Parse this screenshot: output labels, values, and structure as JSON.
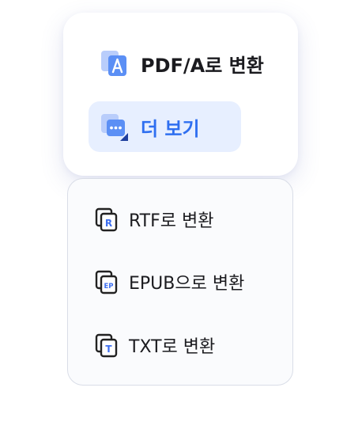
{
  "menu": {
    "items": [
      {
        "label": "PDF/A로 변환",
        "icon": "pdfa-convert-icon"
      },
      {
        "label": "더 보기",
        "icon": "more-formats-icon",
        "selected": true
      }
    ]
  },
  "submenu": {
    "items": [
      {
        "label": "RTF로 변환",
        "icon": "rtf-icon",
        "badge": "R"
      },
      {
        "label": "EPUB으로 변환",
        "icon": "epub-icon",
        "badge": "EP"
      },
      {
        "label": "TXT로 변환",
        "icon": "txt-icon",
        "badge": "T"
      }
    ]
  },
  "colors": {
    "accent": "#2f6ff0",
    "selected_bg": "#e7efff",
    "text": "#1b1b1f",
    "submenu_border": "#d9dde7"
  }
}
